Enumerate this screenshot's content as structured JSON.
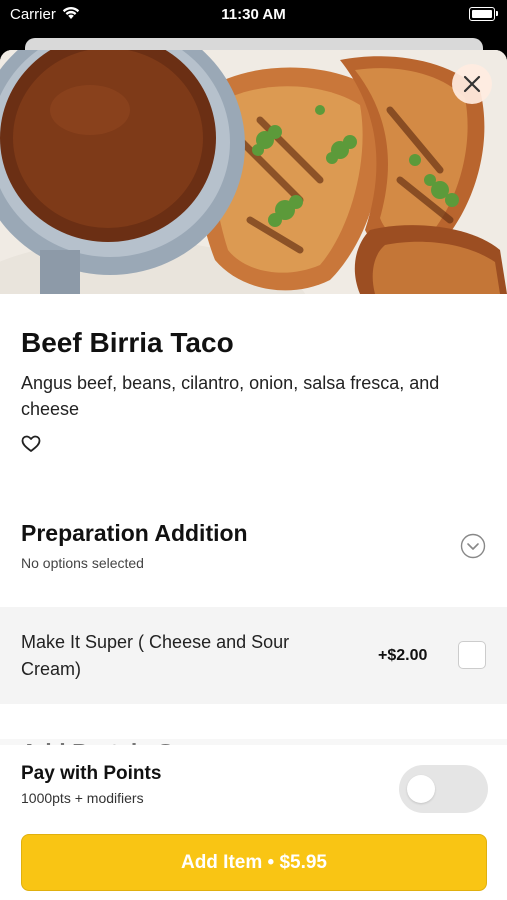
{
  "status_bar": {
    "carrier": "Carrier",
    "time": "11:30 AM"
  },
  "item": {
    "name": "Beef Birria Taco",
    "description": "Angus beef, beans, cilantro, onion, salsa fresca, and cheese"
  },
  "section": {
    "title": "Preparation Addition",
    "subtitle": "No options selected"
  },
  "option": {
    "label": "Make It Super ( Cheese and Sour Cream)",
    "price": "+$2.00",
    "checked": false
  },
  "next_section_peek": "Add Protein Sauce",
  "points": {
    "title": "Pay with Points",
    "subtitle": "1000pts + modifiers",
    "enabled": false
  },
  "add_button": {
    "label": "Add Item • $5.95"
  },
  "colors": {
    "accent": "#F9C514",
    "sheet_background": "#FFFFFF",
    "row_background": "#F4F4F4"
  }
}
